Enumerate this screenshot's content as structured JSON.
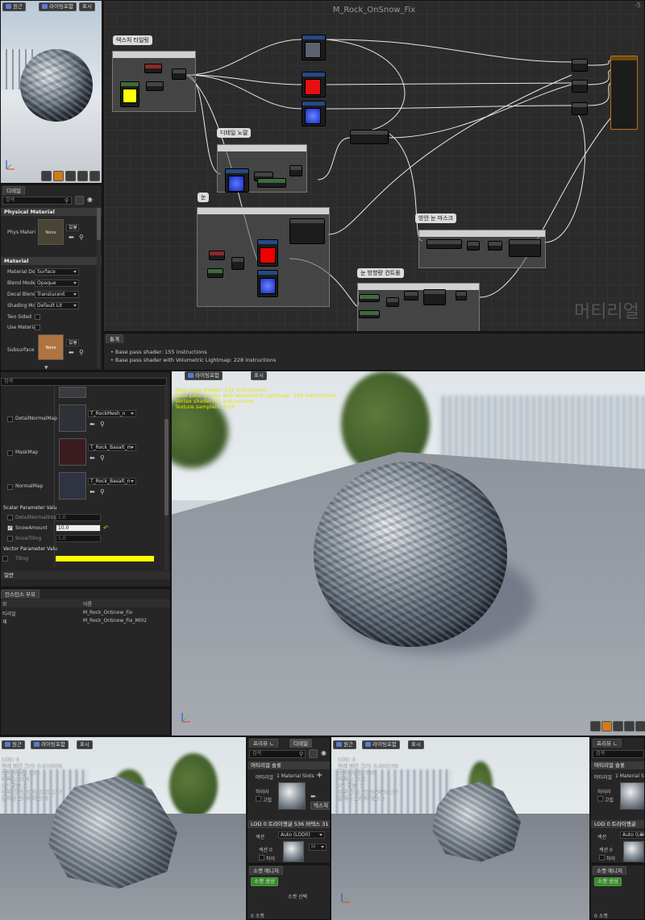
{
  "editor": {
    "graph_title": "M_Rock_OnSnow_Fix",
    "corner_label": "-5",
    "watermark": "머티리얼",
    "preview_toolbar": {
      "perspective": "원근",
      "lighting": "라이팅포함",
      "show": "표시"
    },
    "details_tab": "디테일",
    "search_placeholder": "검색",
    "physical_material": {
      "header": "Physical Material",
      "label": "Phys Materi",
      "thumb_text": "None",
      "dropdown": "없음"
    },
    "material": {
      "header": "Material",
      "rows": [
        {
          "label": "Material Dor",
          "value": "Surface"
        },
        {
          "label": "Blend Mode",
          "value": "Opaque"
        },
        {
          "label": "Decal Blend",
          "value": "Translucent"
        },
        {
          "label": "Shading Mo",
          "value": "Default Lit"
        }
      ],
      "two_sided": "Two Sided",
      "use_material": "Use Materia",
      "subsurface": "Subsurface",
      "subsurface_thumb": "None",
      "subsurface_dropdown": "없음"
    },
    "comments": {
      "tiling": "텍스처 타일링",
      "detail": "디테일 노말",
      "snow": "눈",
      "snow_mask": "방안 눈 마스크",
      "snow_amount": "눈 방향량 컨트롤"
    },
    "stats_tab": "통계",
    "stats": [
      "Base pass shader: 155 instructions",
      "Base pass shader with Volumetric Lightmap: 228 instructions"
    ]
  },
  "instance": {
    "search_placeholder": "검색",
    "texture_params": [
      {
        "label": "DetailNormalMap",
        "value": "T_RockMesh_n",
        "color": "#2f3138"
      },
      {
        "label": "MaskMap",
        "value": "T_Rock_Basalt_m",
        "color": "#3a1c20"
      },
      {
        "label": "NormalMap",
        "value": "T_Rock_Basalt_n",
        "color": "#2f3342"
      }
    ],
    "scalar_header": "Scalar Parameter Valu",
    "scalars": [
      {
        "label": "DetailNormalInter",
        "value": "1.0",
        "checked": false
      },
      {
        "label": "SnowAmount",
        "value": "10.0",
        "checked": true
      },
      {
        "label": "SnowTiling",
        "value": "1.0",
        "checked": false
      }
    ],
    "vector_header": "Vector Parameter Valu",
    "vector": {
      "label": "Tiling",
      "color": "#ffff00"
    },
    "general": "일반",
    "parents_tab": "인스턴스 부모",
    "parents_cols": [
      "모",
      "이름"
    ],
    "parents": [
      {
        "k": "티리얼",
        "v": "M_Rock_OnSnow_Fix"
      },
      {
        "k": "재",
        "v": "M_Rock_OnSnow_Fix_MI02"
      }
    ],
    "viewport_toolbar": {
      "lighting": "라이팅포함",
      "show": "표시"
    },
    "stats": [
      "Base pass shader: 155 instructions",
      "Base pass shader with Volumetric Lightmap: 228 instructions",
      "Vertex shader: 31 instructions",
      "Texture samplers: 9/16"
    ]
  },
  "mesh_left": {
    "toolbar": {
      "perspective": "원근",
      "lighting": "라이팅포함",
      "show": "표시"
    },
    "stats": [
      "LOD: 0",
      "현재 화면 크기: 0.810928",
      "트라이앵글: 536",
      "버텍스: 314",
      "UV 채널: 3",
      "대략 크기: 239x262x177",
      "콜리전 프리미티브: 0"
    ],
    "tabs": {
      "preview": "프리뷰 ㄴ",
      "details": "디테일"
    },
    "search_placeholder": "검색",
    "material_slots": "머티리얼 슬롯",
    "material_label": "머티리얼",
    "slot_count": "1 Material Slots",
    "highlight": "하이라",
    "isolate": "고립",
    "lod_line": "LOD 0 트라이앵글 536 버텍스 31",
    "section": "섹션",
    "section_value": "Auto (LOD0)",
    "section0": "섹션 0",
    "highlight2": "하이",
    "texture_btn": "텍스쳐",
    "socket_manager": "소켓 매니저",
    "socket_create": "소켓 생성",
    "socket_select": "소켓 선택",
    "socket_count": "0 소켓"
  },
  "mesh_right": {
    "toolbar": {
      "perspective": "원근",
      "lighting": "라이팅포함",
      "show": "표시"
    },
    "stats": [
      "LOD: 0",
      "현재 화면 크기: 0.603158",
      "트라이앵글: 536",
      "버텍스: 314",
      "UV 채널: 3",
      "대략 크기: 239x262x177",
      "콜리전 프리미티브: 0"
    ],
    "tabs": {
      "preview": "프리뷰 ㄴ",
      "details": "디테일"
    },
    "search_placeholder": "검색",
    "material_slots": "머티리얼 슬롯",
    "material_label": "머티리얼",
    "slot_count": "1 Material S",
    "highlight": "하이라",
    "isolate": "고립",
    "lod_line": "LOD 0 트라이앵글",
    "section": "섹션",
    "section_value": "Auto (LOD0",
    "section0": "섹션 0",
    "highlight2": "하이",
    "socket_manager": "소켓 매니저",
    "socket_create": "소켓 생성",
    "socket_count": "0 소켓"
  }
}
